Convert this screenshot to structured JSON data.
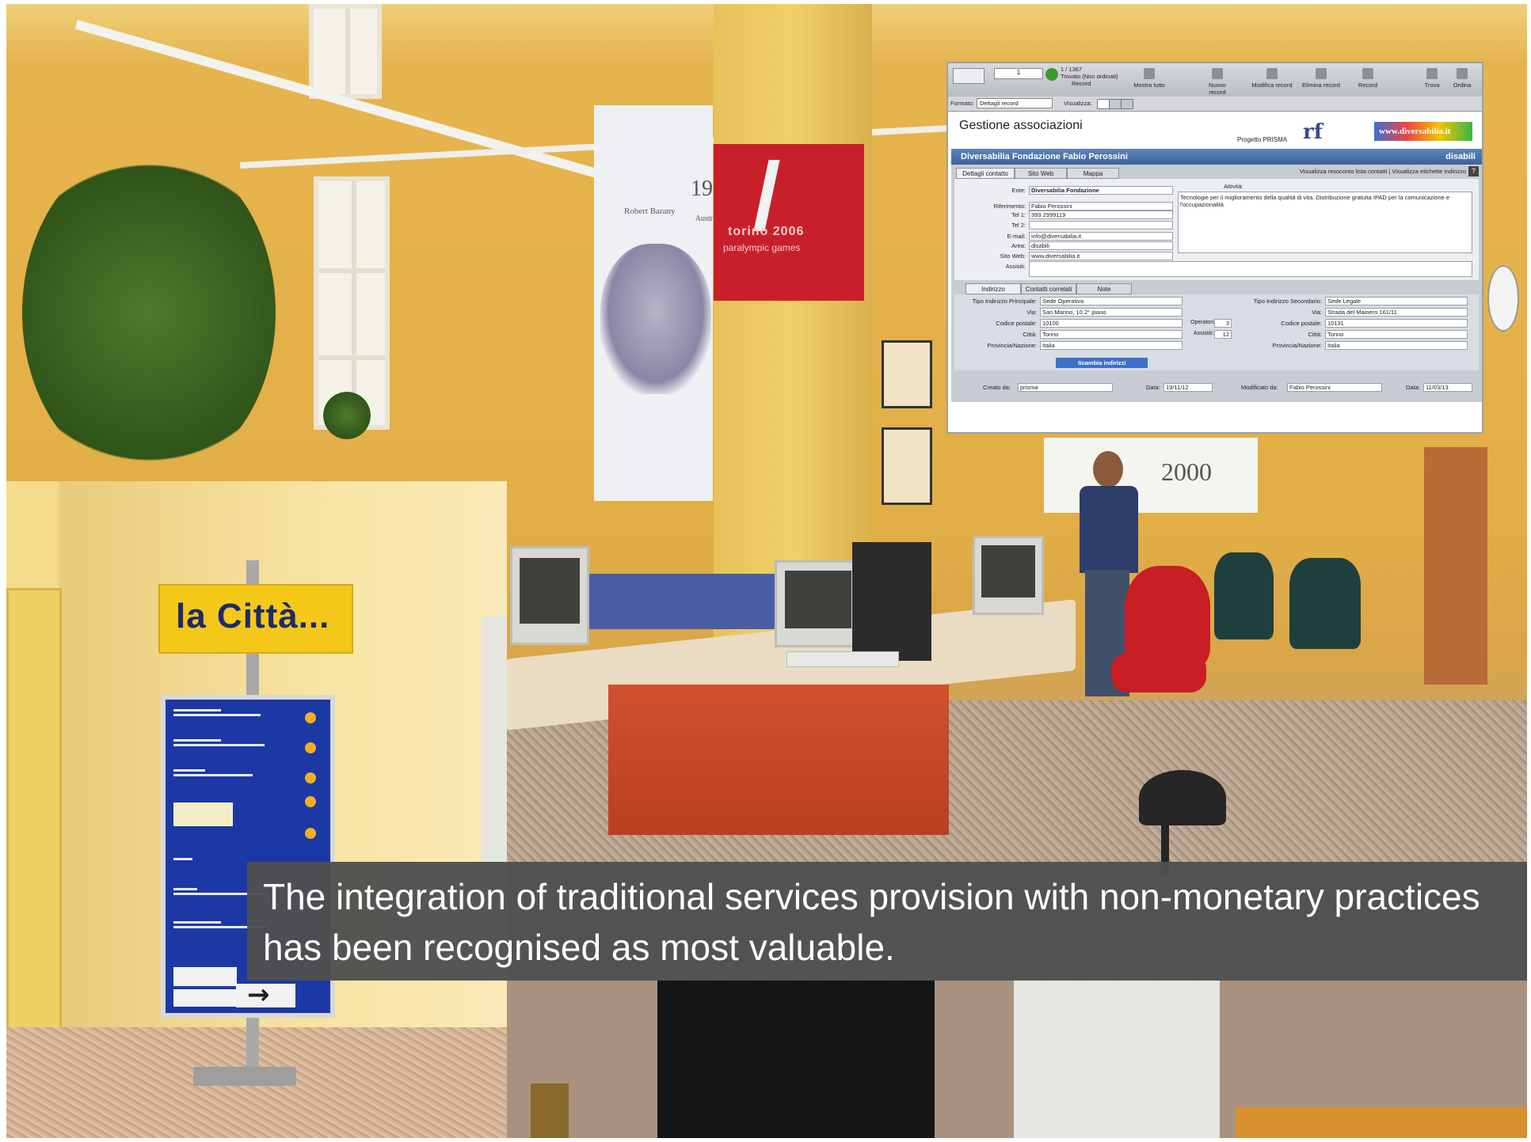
{
  "caption": {
    "text": "The integration of traditional services provision with non-monetary practices has been recognised as most valuable."
  },
  "inset_photo": {
    "sign_title": "la Città..."
  },
  "office_photo": {
    "banner_year": "19",
    "banner_name": "Robert Barany",
    "banner_country": "Austr",
    "red_banner_text": "torino 2006",
    "red_banner_subtext": "paralympic games",
    "wall_sign": "2000"
  },
  "filemaker": {
    "toolbar": {
      "record_number": "1",
      "record_count": "1 / 1367",
      "found_status": "Trovato (Non ordinati)",
      "records_label": "Record",
      "show_all": "Mostra tutto",
      "new_record": "Nuovo record",
      "edit_record": "Modifica record",
      "delete_record": "Elimina record",
      "record_menu": "Record",
      "find": "Trova",
      "sort": "Ordina"
    },
    "layout_bar": {
      "format_label": "Formato:",
      "format_value": "Dettagli record",
      "view_label": "Visualizza:"
    },
    "title": "Gestione associazioni",
    "project": "Progetto PRISMA",
    "logo_text": "www.diversabilia.it",
    "header_name": "Diversabilia Fondazione Fabio Perossini",
    "header_area": "disabili",
    "tabs": [
      "Dettagli contatto",
      "Sito Web",
      "Mappa"
    ],
    "tabs_links": "Visualizza resoconto lista contatti  |  Visualizza etichette indirizzo",
    "help": "?",
    "fields": {
      "ente_label": "Ente:",
      "ente": "Diversabilia Fondazione",
      "riferimento_label": "Riferimento:",
      "riferimento": "Fabio Perossini",
      "tel1_label": "Tel 1:",
      "tel1": "393 2999119",
      "tel2_label": "Tel 2:",
      "tel2": "",
      "email_label": "E-mail:",
      "email": "info@diversabilia.it",
      "area_label": "Area:",
      "area": "disabili",
      "sito_label": "Sito Web:",
      "sito": "www.diversabilia.it",
      "assisiti_label": "Assisiti:",
      "attivita_label": "Attività:",
      "attivita": "Tecnologie per il miglioramento della qualità di vita. Distribuzione gratuita IPAD per la comunicazione e l'occupazionalità"
    },
    "address_tabs": [
      "Indirizzo",
      "Contatti correlati",
      "Note"
    ],
    "address": {
      "tipo_principale_label": "Tipo Indirizzo Principale:",
      "tipo_principale": "Sede Operativa",
      "via_label": "Via:",
      "via": "San Marino, 10 2° piano",
      "cap_label": "Codice postale:",
      "cap": "10100",
      "citta_label": "Città:",
      "citta": "Torino",
      "provincia_label": "Provincia/Nazione:",
      "provincia": "Italia",
      "operatori_label": "Operatori:",
      "operatori": "3",
      "assistiti_label": "Assistiti:",
      "assistiti": "12",
      "tipo_secondario_label": "Tipo Indirizzo Secondario:",
      "tipo_secondario": "Sede Legale",
      "via2": "Strada del Mainero 161/11",
      "cap2": "10131",
      "citta2": "Torino",
      "provincia2": "Italia",
      "swap_button": "Scambia indirizzi"
    },
    "footer": {
      "created_by_label": "Creato da:",
      "created_by": "prisma",
      "created_date_label": "Data:",
      "created_date": "19/11/12",
      "modified_by_label": "Modificato da:",
      "modified_by": "Fabio Perossini",
      "modified_date_label": "Data:",
      "modified_date": "11/03/13"
    }
  }
}
